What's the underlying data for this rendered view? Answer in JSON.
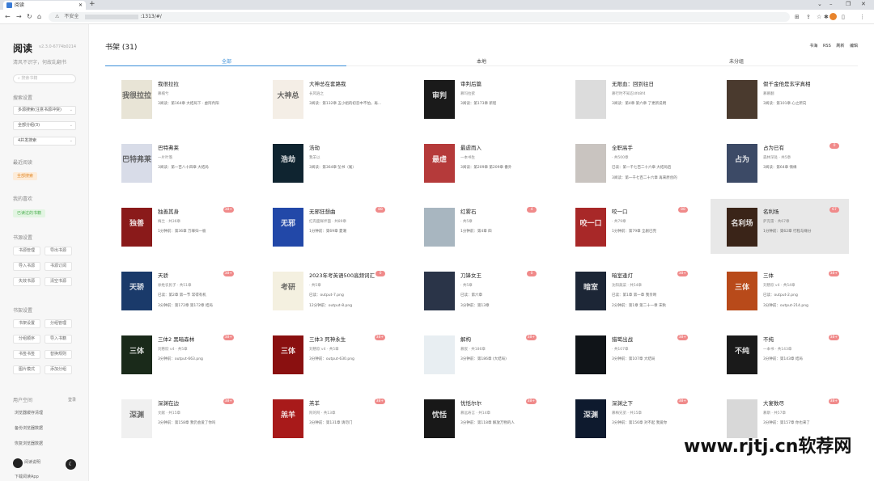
{
  "browser": {
    "tab_title": "阅读",
    "new_tab": "+",
    "omnibox_warning": "不安全",
    "omnibox_url": ":1313/#/",
    "window_controls": [
      "⌄",
      "–",
      "❐",
      "✕"
    ]
  },
  "sidebar": {
    "brand": "阅读",
    "version": "v2.3.0-6774b0214",
    "tagline": "清风不识字，何故乱翻书",
    "search_placeholder": "搜索书籍",
    "search_settings_title": "搜索设置",
    "search_selects": [
      "多源搜索(注意书源冲突)",
      "全部分组(3)",
      "4并发搜索"
    ],
    "reading_history_title": "最近阅读",
    "reading_history_pill": "全部搜索",
    "favorites_title": "我的喜欢",
    "favorites_pill": "已读过的书籍",
    "book_manage_title": "书源设置",
    "book_manage_buttons": [
      "书源管理",
      "导出书源",
      "导入书源",
      "书源订阅",
      "失效书源",
      "清空书源"
    ],
    "shelf_manage_title": "书架设置",
    "shelf_manage_buttons": [
      "书架设置",
      "分组管理",
      "分组顺序",
      "导入书籍",
      "书签书签",
      "替换规则",
      "图片模式",
      "添加分组"
    ],
    "user_title": "用户空间",
    "login": "登录",
    "user_links": [
      "浏览器缓存清理",
      "备份浏览器数据",
      "恢复浏览器数据"
    ],
    "readme": "阅读说明",
    "friends": "下载阅读App"
  },
  "main": {
    "shelf_title": "书架 (31)",
    "actions": [
      "书海",
      "RSS",
      "刷新",
      "编辑"
    ],
    "tabs": [
      "全部",
      "本地",
      "未分组"
    ],
    "books": [
      {
        "name": "我很拉拉",
        "author": "慕楠兮",
        "mid": "",
        "last": "3阅读：第164章 大结局下 · 虚阿冉阳",
        "badge": "",
        "cover": "#e8e4d6",
        "light": true,
        "ctext": "我很拉拉"
      },
      {
        "name": "大神总在套路我",
        "author": "长风逍之",
        "mid": "",
        "last": "3阅读：第132章 五小组的初恋中不怕，再...",
        "badge": "",
        "cover": "#f4eee6",
        "light": true,
        "ctext": "大神总"
      },
      {
        "name": "审判后篇",
        "author": "慕玛拉欲",
        "mid": "",
        "last": "3阅读：第173章 新程",
        "badge": "",
        "cover": "#1a1a1a",
        "light": false,
        "ctext": "审判"
      },
      {
        "name": "无限血：回到往日",
        "author": "慕行时不知忍dfd8f4",
        "mid": "",
        "last": "3阅读：第4章 第六章 了更新说明",
        "badge": "",
        "cover": "#dcdcdc",
        "light": true,
        "ctext": ""
      },
      {
        "name": "假千金他是玄学真相",
        "author": "慕慕翻",
        "mid": "",
        "last": "3阅读：第101章 心之所向",
        "badge": "",
        "cover": "#4a3a2e",
        "light": false,
        "ctext": ""
      },
      {
        "name": "巴特弗莱",
        "author": "一片叶落",
        "mid": "",
        "last": "3阅读：第一百八十四章 大结局",
        "badge": "",
        "cover": "#d8dce8",
        "light": true,
        "ctext": "巴特弗莱"
      },
      {
        "name": "浩劫",
        "author": "我羊以",
        "mid": "",
        "last": "3阅读：第364章 坠书（尾）",
        "badge": "",
        "cover": "#0f2430",
        "light": false,
        "ctext": "浩劫"
      },
      {
        "name": "最虐而入",
        "author": "一本书生",
        "mid": "",
        "last": "3阅读：第209章 第209章 番外",
        "badge": "",
        "cover": "#b53a3a",
        "light": false,
        "ctext": "最虐"
      },
      {
        "name": "全职高手",
        "author": "· 共500章",
        "mid": "已读：第一千七百二十六章 大结局后",
        "last": "3阅读：第一千七百二十六章 再来原创的",
        "badge": "",
        "cover": "#c9c4c0",
        "light": true,
        "ctext": ""
      },
      {
        "name": "占为已有",
        "author": "森林深处 · 共5章",
        "mid": "",
        "last": "3阅读：第64章 情缘",
        "badge": "0",
        "cover": "#3c4a66",
        "light": false,
        "ctext": "占为"
      },
      {
        "name": "独善其身",
        "author": "梅兰 · 共36章",
        "mid": "",
        "last": "1分钟前：第36章 万罪归一彼",
        "badge": "38+",
        "cover": "#8a1a1a",
        "light": false,
        "ctext": "独善"
      },
      {
        "name": "无邪狂想曲",
        "author": "红肉面鲜拌面 · 共89章",
        "mid": "",
        "last": "1分钟前：第69章 夏潮",
        "badge": "88",
        "cover": "#2248a8",
        "light": false,
        "ctext": "无邪"
      },
      {
        "name": "红雾石",
        "author": "· 共5章",
        "mid": "",
        "last": "1分钟前：第4章 四",
        "badge": "4",
        "cover": "#a8b6c0",
        "light": true,
        "ctext": ""
      },
      {
        "name": "咬一口",
        "author": "· 共79章",
        "mid": "",
        "last": "1分钟前：第79章 全剧已完",
        "badge": "88",
        "cover": "#a82828",
        "light": false,
        "ctext": "咬一口"
      },
      {
        "name": "名利场",
        "author": "萨克雷 · 共67章",
        "mid": "",
        "last": "1分钟前：第62章 行程与缘分",
        "badge": "67",
        "cover": "#3a2418",
        "light": false,
        "ctext": "名利场"
      },
      {
        "name": "天骄",
        "author": "徐姓农民子 · 共51章",
        "mid": "已读：第2章 第一节 常得有机",
        "last": "3分钟前：第172章 第172章 结局",
        "badge": "38+",
        "cover": "#1a3a6a",
        "light": false,
        "ctext": "天骄"
      },
      {
        "name": "2023年考英语500高频词汇",
        "author": "· 共5章",
        "mid": "已读：output-7.png",
        "last": "12分钟前：output-8.png",
        "badge": "0",
        "cover": "#f4f0e0",
        "light": true,
        "ctext": "考研"
      },
      {
        "name": "刀锋女王",
        "author": "· 共5章",
        "mid": "已读：第六章",
        "last": "3分钟前：第13章",
        "badge": "0",
        "cover": "#2a3448",
        "light": false,
        "ctext": ""
      },
      {
        "name": "暗室逢灯",
        "author": "沈阳蔬菜 · 共54章",
        "mid": "已读：第1章 第一章 我亲吻",
        "last": "2分钟前：第1章 第二十一章 宋秋",
        "badge": "38+",
        "cover": "#1c2636",
        "light": false,
        "ctext": "暗室"
      },
      {
        "name": "三体",
        "author": "刘慈欣 v4 · 共54章",
        "mid": "已读：output-2.png",
        "last": "3分钟前：output-214.png",
        "badge": "38+",
        "cover": "#b84a1a",
        "light": false,
        "ctext": "三体"
      },
      {
        "name": "三体2 黑暗森林",
        "author": "刘慈欣 v4 · 共5章",
        "mid": "",
        "last": "3分钟前：output-663.png",
        "badge": "38+",
        "cover": "#1a2a1a",
        "light": false,
        "ctext": "三体"
      },
      {
        "name": "三体3 死神永生",
        "author": "刘慈欣 v4 · 共5章",
        "mid": "",
        "last": "3分钟前：output-630.png",
        "badge": "38+",
        "cover": "#8a1010",
        "light": false,
        "ctext": "三体"
      },
      {
        "name": "解构",
        "author": "慕宸 · 共186章",
        "mid": "",
        "last": "3分钟前：第186章 (大结局)",
        "badge": "38+",
        "cover": "#e8eef2",
        "light": true,
        "ctext": ""
      },
      {
        "name": "猎鹫出战",
        "author": "· 共107章",
        "mid": "",
        "last": "3分钟前：第107章 大结局",
        "badge": "38+",
        "cover": "#101418",
        "light": false,
        "ctext": ""
      },
      {
        "name": "不纯",
        "author": "一本书 · 共143章",
        "mid": "",
        "last": "3分钟前：第143章 结局",
        "badge": "38+",
        "cover": "#1a1a1a",
        "light": false,
        "ctext": "不纯"
      },
      {
        "name": "深渊在边",
        "author": "文献 · 共15章",
        "mid": "",
        "last": "3分钟前：第158章 我仍会爱了你吗",
        "badge": "38+",
        "cover": "#f0f0f0",
        "light": true,
        "ctext": "深渊"
      },
      {
        "name": "羔羊",
        "author": "阿的阿 · 共13章",
        "mid": "",
        "last": "3分钟前：第131章 请勿门",
        "badge": "38+",
        "cover": "#a81a1a",
        "light": false,
        "ctext": "羔羊"
      },
      {
        "name": "忧恬尔尔",
        "author": "慕远寿言 · 共14章",
        "mid": "",
        "last": "3分钟前：第118章 解放万物的人",
        "badge": "38+",
        "cover": "#181818",
        "light": false,
        "ctext": "忧恬"
      },
      {
        "name": "深渊之下",
        "author": "慕梅兄弟 · 共15章",
        "mid": "",
        "last": "3分钟前：第156章 对不起 我爱你",
        "badge": "38+",
        "cover": "#0e1a2e",
        "light": false,
        "ctext": "深渊"
      },
      {
        "name": "大宴数尽",
        "author": "慕斯 · 共57章",
        "mid": "",
        "last": "3分钟前：第157章 你也来了",
        "badge": "38+",
        "cover": "#d8d8d8",
        "light": true,
        "ctext": ""
      }
    ]
  },
  "watermark": "www.rjtj.cn软荐网",
  "colors": {
    "accent": "#3a8fd8",
    "badge": "#f08a8a",
    "pill_orange": "#fdecd9",
    "pill_green": "#e3f5e3"
  }
}
